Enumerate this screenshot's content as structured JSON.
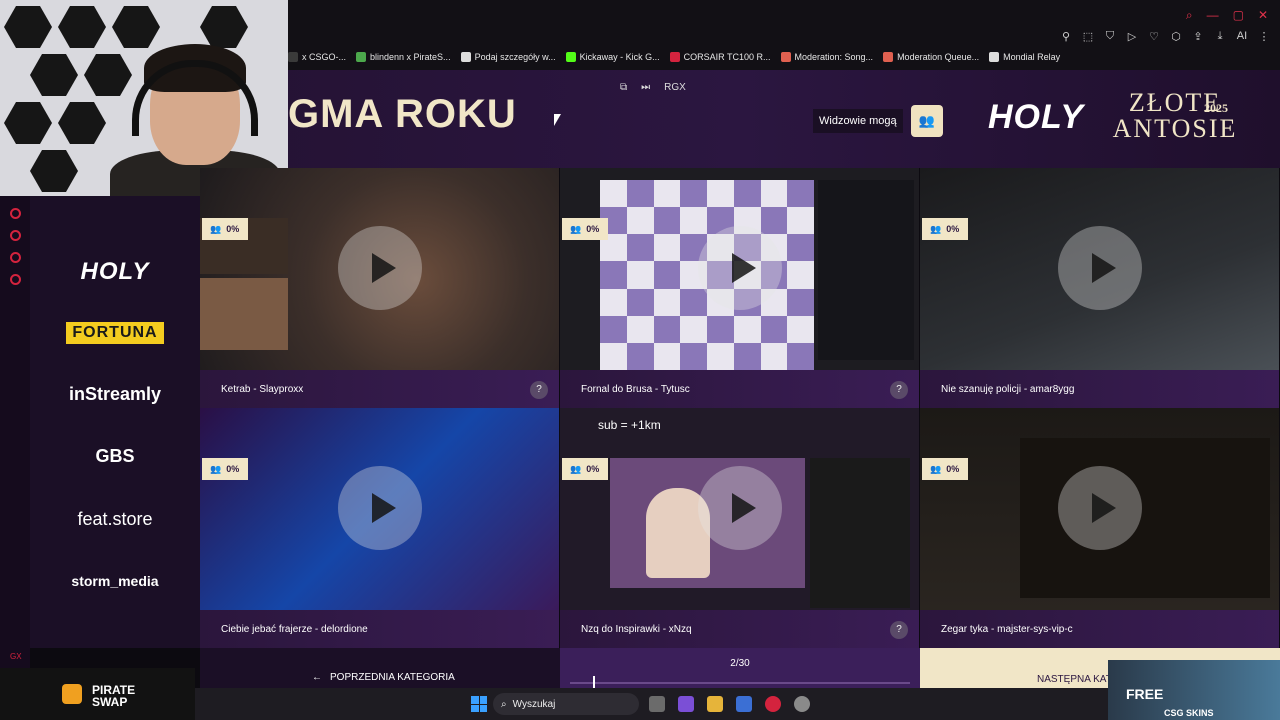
{
  "browser": {
    "bookmarks": [
      {
        "label": "x CSGO-...",
        "color": "#3a3a3a"
      },
      {
        "label": "blindenn x PirateS...",
        "color": "#4ca84c"
      },
      {
        "label": "Podaj szczegóły w...",
        "color": "#dddddd"
      },
      {
        "label": "Kickaway - Kick G...",
        "color": "#53fc18"
      },
      {
        "label": "CORSAIR TC100 R...",
        "color": "#d4233e"
      },
      {
        "label": "Moderation: Song...",
        "color": "#e06050"
      },
      {
        "label": "Moderation Queue...",
        "color": "#e06050"
      },
      {
        "label": "Mondial Relay",
        "color": "#dddddd"
      }
    ],
    "toolbar_ai": "AI"
  },
  "header": {
    "category_title": "GMA ROKU",
    "controls": {
      "gx": "RGX"
    },
    "viewers_label": "Widzowie mogą",
    "brand": "HOLY",
    "award_line1": "ZŁOTE",
    "award_line2": "ANTOSIE",
    "award_year": "2025"
  },
  "sidebar": {
    "sponsors": [
      "HOLY",
      "FORTUNA",
      "inStreamly",
      "GBS",
      "feat.store",
      "storm_media"
    ],
    "rail_label": "GX"
  },
  "clips": [
    {
      "title": "Ketrab - Slayproxx",
      "percent": "0%",
      "help": "?"
    },
    {
      "title": "Fornal do Brusa - Tytusc",
      "percent": "0%",
      "help": "?"
    },
    {
      "title": "Nie szanuję policji - amar8ygg",
      "percent": "0%",
      "help": ""
    },
    {
      "title": "Ciebie jebać frajerze - delordione",
      "percent": "0%",
      "help": ""
    },
    {
      "title": "Nzq do Inspirawki - xNzq",
      "percent": "0%",
      "help": "?"
    },
    {
      "title": "Zegar tyka - majster-sys-vip-c",
      "percent": "0%",
      "help": ""
    }
  ],
  "clip_overlay_text": "sub = +1km",
  "nav": {
    "prev_label": "POPRZEDNIA KATEGORIA",
    "counter": "2/30",
    "progress_fraction": 0.067,
    "next_label": "NASTĘPNA KAT"
  },
  "overlays": {
    "pirate_line1": "PIRATE",
    "pirate_line2": "SWAP",
    "csg_free": "FREE",
    "csg_brand": "CSG SKINS"
  },
  "taskbar": {
    "search_placeholder": "Wyszukaj"
  }
}
